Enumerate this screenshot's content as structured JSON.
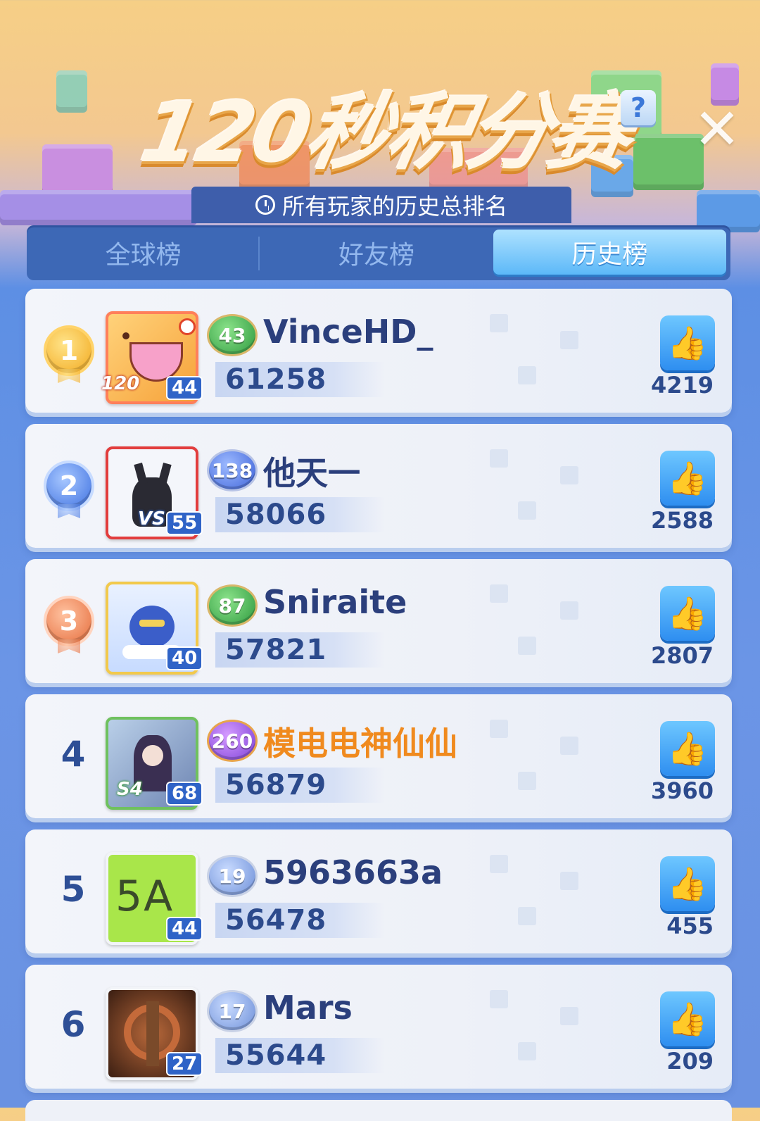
{
  "header": {
    "title": "120秒积分赛",
    "help_icon": "question-icon",
    "help_label": "?",
    "close_icon": "close-icon",
    "subtitle": "所有玩家的历史总排名"
  },
  "tabs": [
    {
      "label": "全球榜",
      "active": false
    },
    {
      "label": "好友榜",
      "active": false
    },
    {
      "label": "历史榜",
      "active": true
    }
  ],
  "rows": [
    {
      "rank": "1",
      "level": "43",
      "name": "VinceHD_",
      "score": "61258",
      "likes": "4219",
      "avatar_level": "44",
      "avatar_tag": "120"
    },
    {
      "rank": "2",
      "level": "138",
      "name": "他天一",
      "score": "58066",
      "likes": "2588",
      "avatar_level": "55",
      "avatar_tag": "VS"
    },
    {
      "rank": "3",
      "level": "87",
      "name": "Sniraite",
      "score": "57821",
      "likes": "2807",
      "avatar_level": "40"
    },
    {
      "rank": "4",
      "level": "260",
      "name": "模电电神仙仙",
      "score": "56879",
      "likes": "3960",
      "avatar_level": "68",
      "avatar_tag": "S4"
    },
    {
      "rank": "5",
      "level": "19",
      "name": "5963663a",
      "score": "56478",
      "likes": "455",
      "avatar_level": "44",
      "avatar_text": "5A"
    },
    {
      "rank": "6",
      "level": "17",
      "name": "Mars",
      "score": "55644",
      "likes": "209",
      "avatar_level": "27"
    }
  ],
  "colors": {
    "accent": "#3d68b6",
    "active_tab": "#5cb8f8",
    "name_highlight": "#f08a1e",
    "like_button": "#2e8ef0"
  }
}
